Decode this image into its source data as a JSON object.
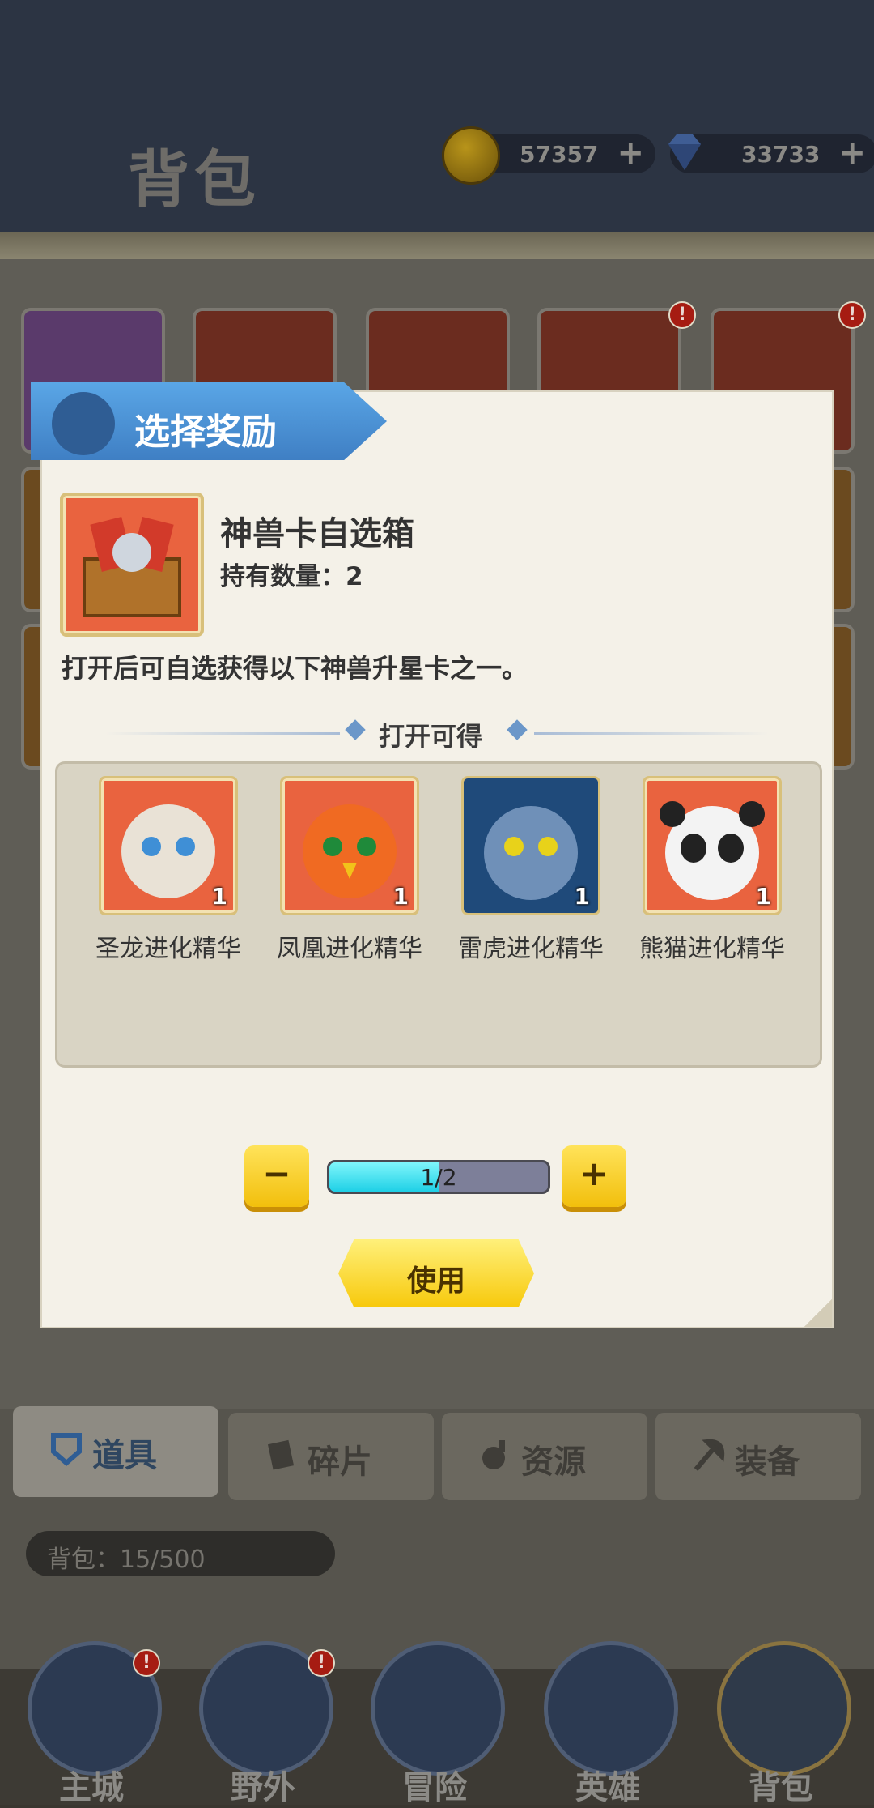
{
  "page": {
    "title": "背包"
  },
  "currency": {
    "gold": {
      "value": "57357",
      "plus": "+",
      "icon": "gold-coin-icon"
    },
    "gems": {
      "value": "33733",
      "plus": "+",
      "icon": "diamond-icon"
    }
  },
  "dialog": {
    "header": "选择奖励",
    "item": {
      "name": "神兽卡自选箱",
      "count_label": "持有数量：2"
    },
    "description": "打开后可自选获得以下神兽升星卡之一。",
    "section_label": "打开可得",
    "rewards": [
      {
        "name": "圣龙进化精华",
        "qty": "1"
      },
      {
        "name": "凤凰进化精华",
        "qty": "1"
      },
      {
        "name": "雷虎进化精华",
        "qty": "1"
      },
      {
        "name": "熊猫进化精华",
        "qty": "1"
      }
    ],
    "stepper": {
      "minus": "−",
      "plus": "+",
      "progress_text": "1/2",
      "progress_fraction": 0.5
    },
    "use_label": "使用"
  },
  "tabs": [
    {
      "label": "道具",
      "icon": "shield-icon",
      "active": true
    },
    {
      "label": "碎片",
      "icon": "card-fragment-icon"
    },
    {
      "label": "资源",
      "icon": "potion-icon"
    },
    {
      "label": "装备",
      "icon": "axe-icon"
    }
  ],
  "bag_capacity": "背包：15/500",
  "nav": [
    {
      "label": "主城",
      "badge": "!"
    },
    {
      "label": "野外",
      "badge": "!"
    },
    {
      "label": "冒险"
    },
    {
      "label": "英雄"
    },
    {
      "label": "背包"
    }
  ],
  "colors": {
    "accent_blue": "#4a90d9",
    "button_yellow": "#f7c90c",
    "progress_cyan": "#1fd0e6"
  }
}
